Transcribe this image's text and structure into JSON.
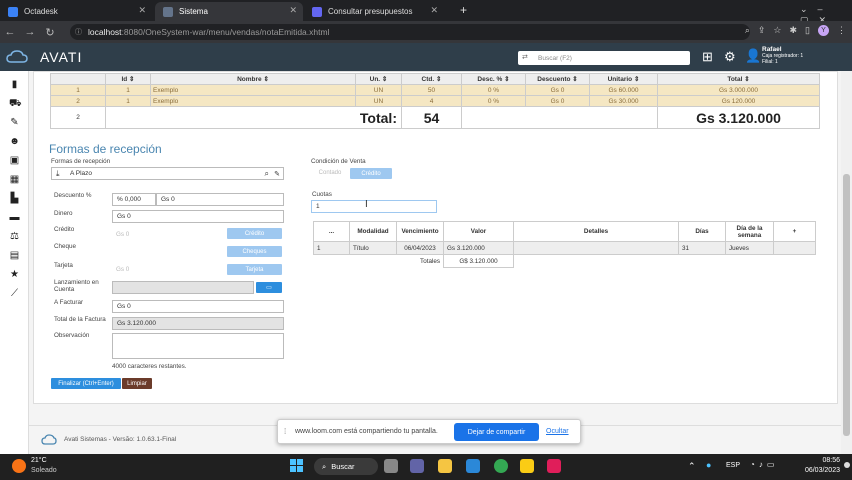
{
  "browser": {
    "tabs": [
      {
        "label": "Octadesk",
        "color": "#3b82f6"
      },
      {
        "label": "Sistema",
        "color": "#64748b"
      },
      {
        "label": "Consultar presupuestos",
        "color": "#6366f1"
      }
    ],
    "url_host": "localhost",
    "url_path": ":8080/OneSystem-war/menu/vendas/notaEmitida.xhtml"
  },
  "app": {
    "logo": "AVATI",
    "search_placeholder": "Buscar (F2)",
    "user_name": "Rafael",
    "user_line2": "Caja registrador: 1",
    "user_line3": "Filial: 1"
  },
  "items_table": {
    "headers": [
      "",
      "Id",
      "Nombre",
      "Un.",
      "Ctd.",
      "Desc. %",
      "Descuento",
      "Unitario",
      "Total"
    ],
    "rows": [
      [
        "1",
        "1",
        "Exemplo",
        "UN",
        "50",
        "0 %",
        "Gs 0",
        "Gs 60.000",
        "Gs 3.000.000"
      ],
      [
        "2",
        "1",
        "Exemplo",
        "UN",
        "4",
        "0 %",
        "Gs 0",
        "Gs 30.000",
        "Gs 120.000"
      ]
    ],
    "summary": {
      "count": "2",
      "total_label": "Total:",
      "qty": "54",
      "total": "Gs 3.120.000"
    }
  },
  "reception": {
    "title": "Formas de recepción",
    "forms_label": "Formas de recepción",
    "forms_value": "A Plazo",
    "discount_label": "Descuento %",
    "discount_pct": "% 0,000",
    "discount_amount": "Gs 0",
    "money_label": "Dinero",
    "money_value": "Gs 0",
    "credit_label": "Crédito",
    "credit_value": "Gs 0",
    "credit_btn": "Crédito",
    "check_label": "Cheque",
    "check_btn": "Cheques",
    "card_label": "Tarjeta",
    "card_value": "Gs 0",
    "card_btn": "Tarjeta",
    "account_label": "Lanzamiento en Cuenta",
    "invoice_label": "A Facturar",
    "invoice_value": "Gs 0",
    "invoice_total_label": "Total de la Factura",
    "invoice_total_value": "Gs 3.120.000",
    "note_label": "Observación",
    "chars_left": "4000 caracteres restantes.",
    "finish_btn": "Finalizar (Ctrl+Enter)",
    "clear_btn": "Limpiar"
  },
  "sale": {
    "condition_label": "Condición de Venta",
    "opt_cash": "Contado",
    "opt_credit": "Crédito",
    "installments_label": "Cuotas",
    "installments_value": "1"
  },
  "payments_table": {
    "headers": [
      "...",
      "Modalidad",
      "Vencimiento",
      "Valor",
      "Detalles",
      "Días",
      "Día de la semana",
      "+"
    ],
    "row": [
      "1",
      "Título",
      "06/04/2023",
      "Gs 3.120.000",
      "",
      "31",
      "Jueves",
      ""
    ],
    "totals_label": "Totales",
    "totals_value": "G$ 3.120.000"
  },
  "footer": {
    "text": "Avati Sistemas - Versão: 1.0.63.1-Final"
  },
  "loom": {
    "message": "www.loom.com está compartiendo tu pantalla.",
    "stop_btn": "Dejar de compartir",
    "hide_btn": "Ocultar"
  },
  "taskbar": {
    "temp": "21°C",
    "weather": "Soleado",
    "search": "Buscar",
    "lang": "ESP",
    "time": "08:56",
    "date": "06/03/2023"
  }
}
